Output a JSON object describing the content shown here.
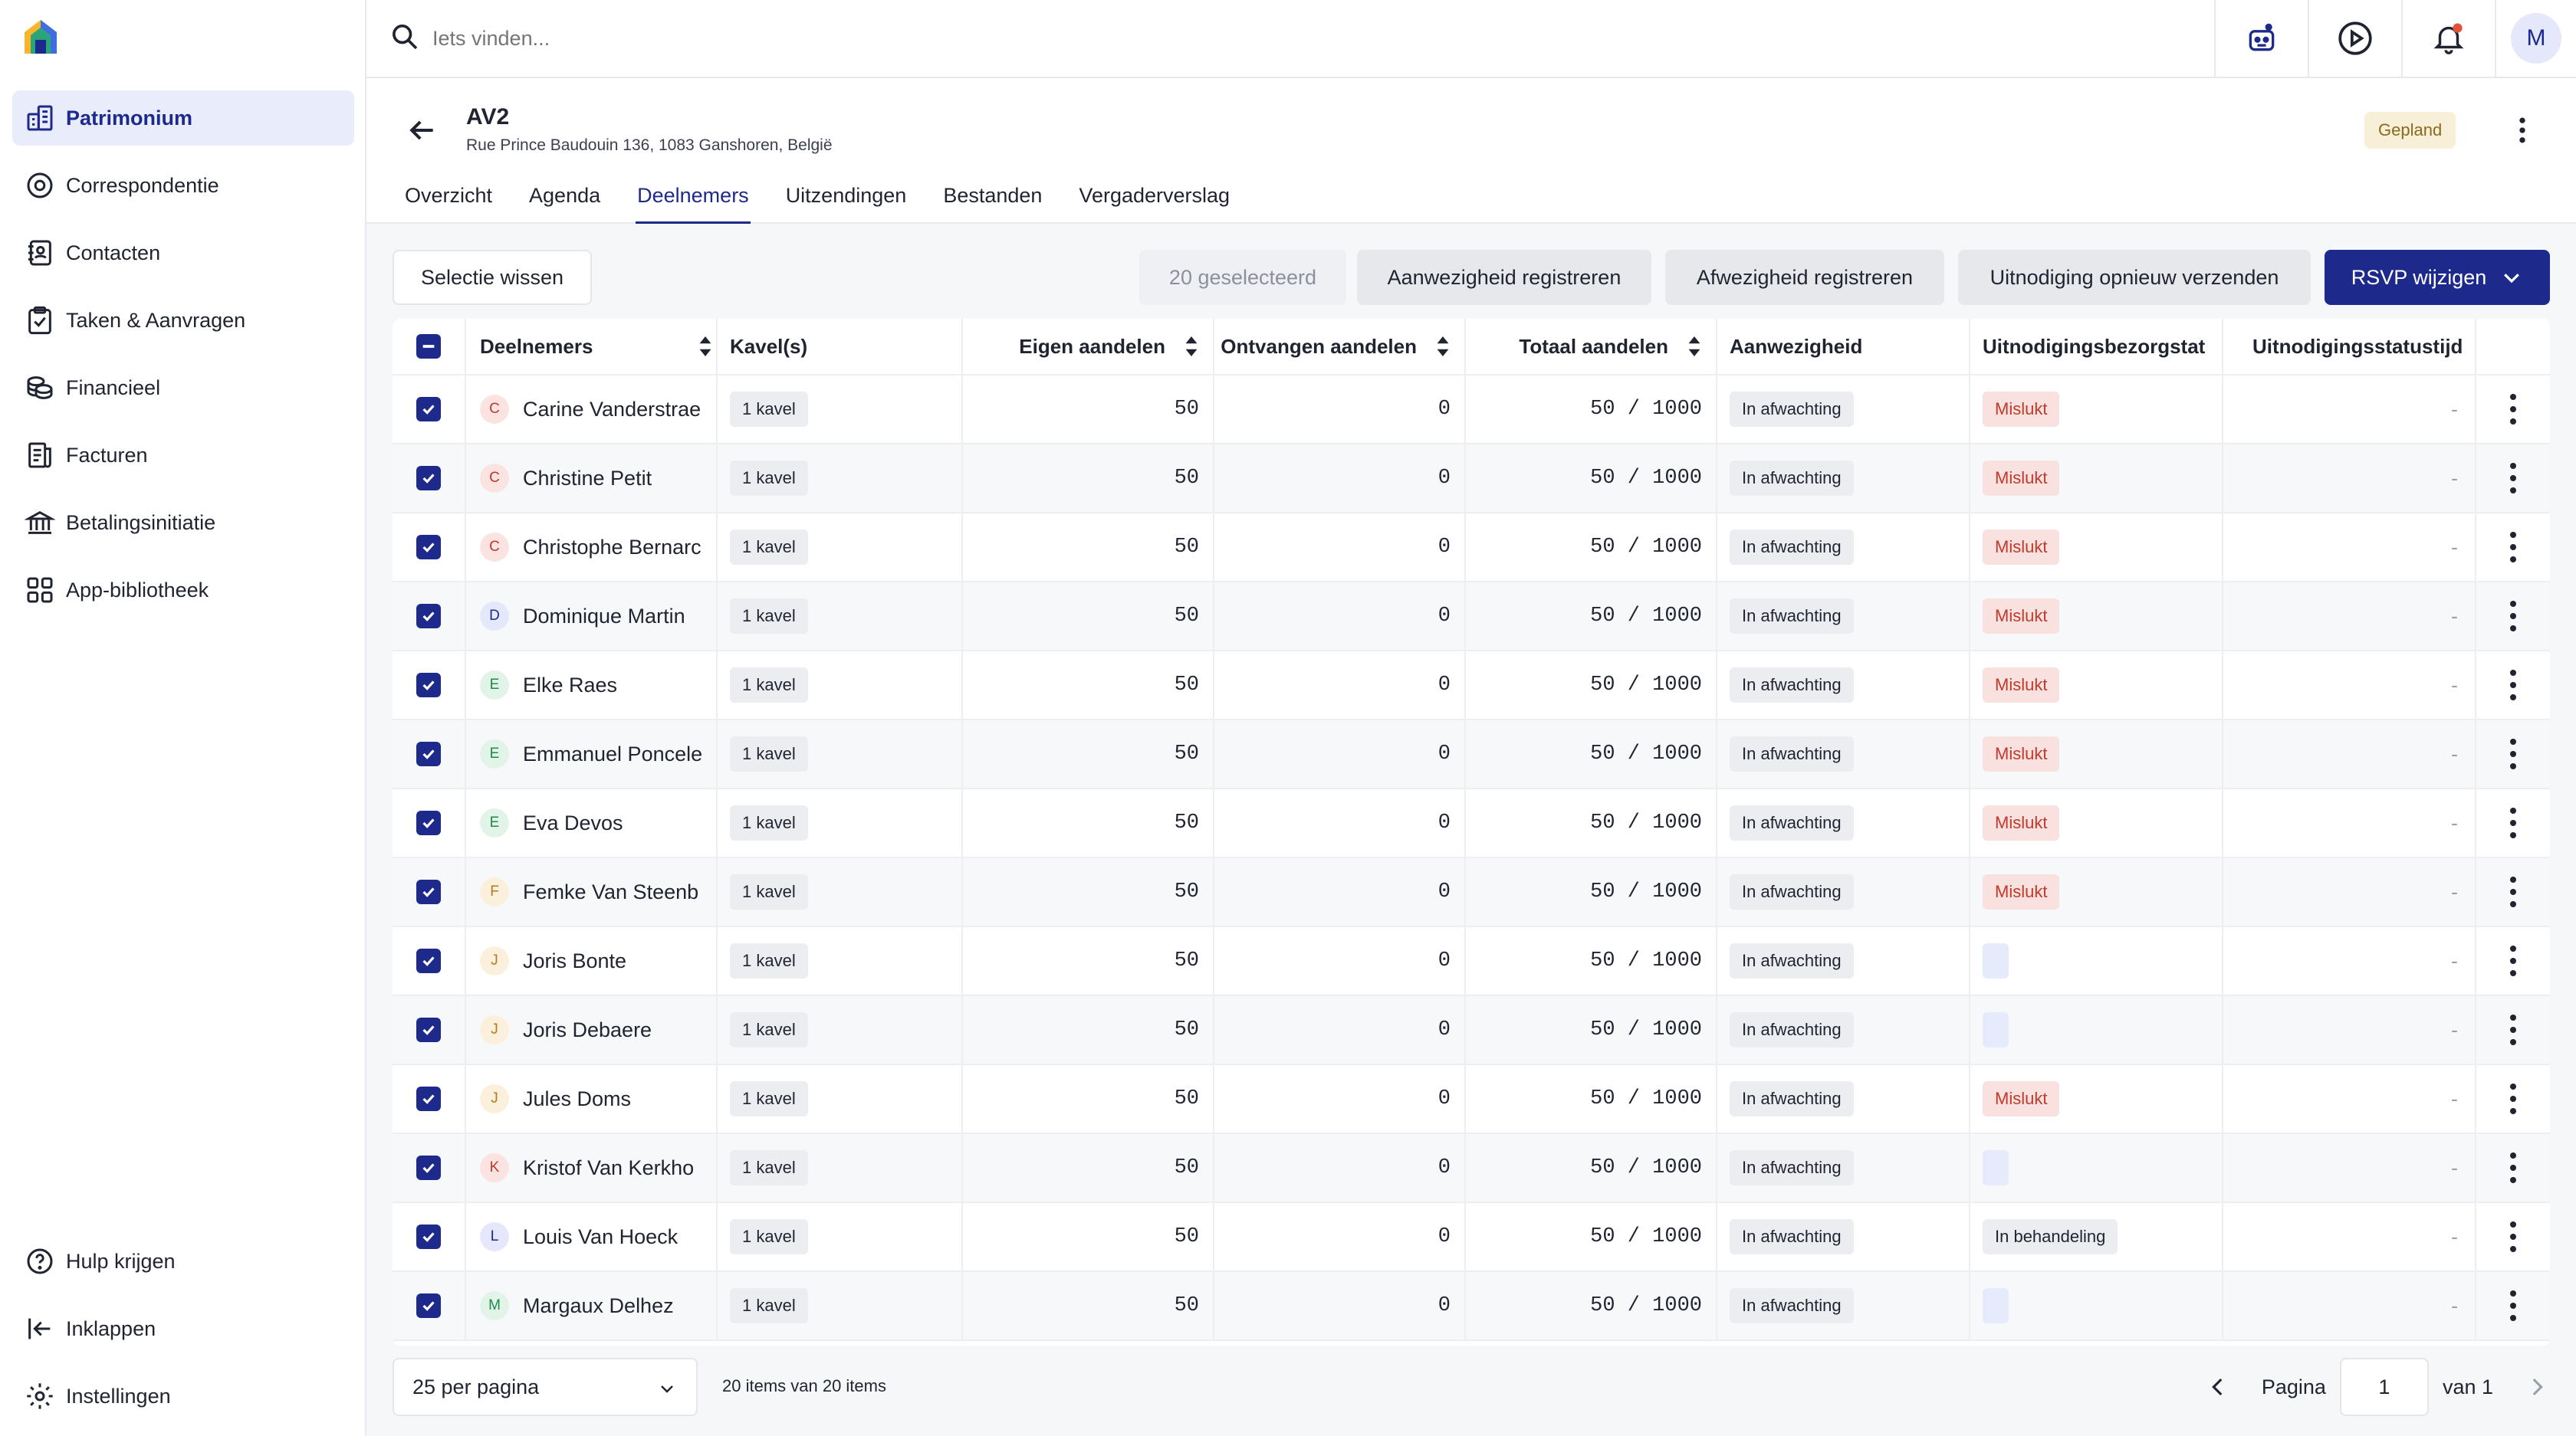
{
  "colors": {
    "primary": "#1d2a8c",
    "active_nav_bg": "#e9ecfb",
    "failed_text": "#c0392b",
    "failed_bg": "#f9e1df",
    "planned_bg": "#f8efd9",
    "notification_dot": "#e2523b"
  },
  "sidebar": {
    "items": [
      {
        "label": "Patrimonium",
        "icon": "building-icon"
      },
      {
        "label": "Correspondentie",
        "icon": "at-sign-icon"
      },
      {
        "label": "Contacten",
        "icon": "contacts-book-icon"
      },
      {
        "label": "Taken & Aanvragen",
        "icon": "clipboard-check-icon"
      },
      {
        "label": "Financieel",
        "icon": "coins-icon"
      },
      {
        "label": "Facturen",
        "icon": "invoice-icon"
      },
      {
        "label": "Betalingsinitiatie",
        "icon": "bank-icon"
      },
      {
        "label": "App-bibliotheek",
        "icon": "apps-grid-icon"
      }
    ],
    "bottom": [
      {
        "label": "Hulp krijgen",
        "icon": "help-circle-icon"
      },
      {
        "label": "Inklappen",
        "icon": "collapse-icon"
      },
      {
        "label": "Instellingen",
        "icon": "gear-icon"
      }
    ]
  },
  "topbar": {
    "search_placeholder": "Iets vinden...",
    "avatar_initial": "M"
  },
  "header": {
    "title": "AV2",
    "address": "Rue Prince Baudouin 136, 1083 Ganshoren, België",
    "status": "Gepland",
    "tabs": [
      "Overzicht",
      "Agenda",
      "Deelnemers",
      "Uitzendingen",
      "Bestanden",
      "Vergaderverslag"
    ],
    "active_tab": "Deelnemers"
  },
  "actions": {
    "clear_selection": "Selectie wissen",
    "selected_count": "20 geselecteerd",
    "register_presence": "Aanwezigheid registreren",
    "register_absence": "Afwezigheid registreren",
    "resend_invitation": "Uitnodiging opnieuw verzenden",
    "change_rsvp": "RSVP wijzigen"
  },
  "table": {
    "columns": [
      "Deelnemers",
      "Kavel(s)",
      "Eigen aandelen",
      "Ontvangen aandelen",
      "Totaal aandelen",
      "Aanwezigheid",
      "Uitnodigingsbezorgstat",
      "Uitnodigingsstatustijd"
    ],
    "rows": [
      {
        "initial": "C",
        "name": "Carine Vanderstrae",
        "lots": "1 kavel",
        "own": "50",
        "received": "0",
        "total": "50 / 1000",
        "presence": "In afwachting",
        "delivery": "Mislukt",
        "status_time": "-"
      },
      {
        "initial": "C",
        "name": "Christine Petit",
        "lots": "1 kavel",
        "own": "50",
        "received": "0",
        "total": "50 / 1000",
        "presence": "In afwachting",
        "delivery": "Mislukt",
        "status_time": "-"
      },
      {
        "initial": "C",
        "name": "Christophe Bernarc",
        "lots": "1 kavel",
        "own": "50",
        "received": "0",
        "total": "50 / 1000",
        "presence": "In afwachting",
        "delivery": "Mislukt",
        "status_time": "-"
      },
      {
        "initial": "D",
        "name": "Dominique Martin",
        "lots": "1 kavel",
        "own": "50",
        "received": "0",
        "total": "50 / 1000",
        "presence": "In afwachting",
        "delivery": "Mislukt",
        "status_time": "-"
      },
      {
        "initial": "E",
        "name": "Elke Raes",
        "lots": "1 kavel",
        "own": "50",
        "received": "0",
        "total": "50 / 1000",
        "presence": "In afwachting",
        "delivery": "Mislukt",
        "status_time": "-"
      },
      {
        "initial": "E",
        "name": "Emmanuel Poncele",
        "lots": "1 kavel",
        "own": "50",
        "received": "0",
        "total": "50 / 1000",
        "presence": "In afwachting",
        "delivery": "Mislukt",
        "status_time": "-"
      },
      {
        "initial": "E",
        "name": "Eva Devos",
        "lots": "1 kavel",
        "own": "50",
        "received": "0",
        "total": "50 / 1000",
        "presence": "In afwachting",
        "delivery": "Mislukt",
        "status_time": "-"
      },
      {
        "initial": "F",
        "name": "Femke Van Steenb",
        "lots": "1 kavel",
        "own": "50",
        "received": "0",
        "total": "50 / 1000",
        "presence": "In afwachting",
        "delivery": "Mislukt",
        "status_time": "-"
      },
      {
        "initial": "J",
        "name": "Joris Bonte",
        "lots": "1 kavel",
        "own": "50",
        "received": "0",
        "total": "50 / 1000",
        "presence": "In afwachting",
        "delivery": "",
        "status_time": "-"
      },
      {
        "initial": "J",
        "name": "Joris Debaere",
        "lots": "1 kavel",
        "own": "50",
        "received": "0",
        "total": "50 / 1000",
        "presence": "In afwachting",
        "delivery": "",
        "status_time": "-"
      },
      {
        "initial": "J",
        "name": "Jules Doms",
        "lots": "1 kavel",
        "own": "50",
        "received": "0",
        "total": "50 / 1000",
        "presence": "In afwachting",
        "delivery": "Mislukt",
        "status_time": "-"
      },
      {
        "initial": "K",
        "name": "Kristof Van Kerkho",
        "lots": "1 kavel",
        "own": "50",
        "received": "0",
        "total": "50 / 1000",
        "presence": "In afwachting",
        "delivery": "",
        "status_time": "-"
      },
      {
        "initial": "L",
        "name": "Louis Van Hoeck",
        "lots": "1 kavel",
        "own": "50",
        "received": "0",
        "total": "50 / 1000",
        "presence": "In afwachting",
        "delivery": "In behandeling",
        "status_time": "-"
      },
      {
        "initial": "M",
        "name": "Margaux Delhez",
        "lots": "1 kavel",
        "own": "50",
        "received": "0",
        "total": "50 / 1000",
        "presence": "In afwachting",
        "delivery": "",
        "status_time": "-"
      }
    ]
  },
  "footer": {
    "per_page": "25 per pagina",
    "items_count": "20 items van 20 items",
    "page_label": "Pagina",
    "page_value": "1",
    "of_label": "van 1"
  }
}
